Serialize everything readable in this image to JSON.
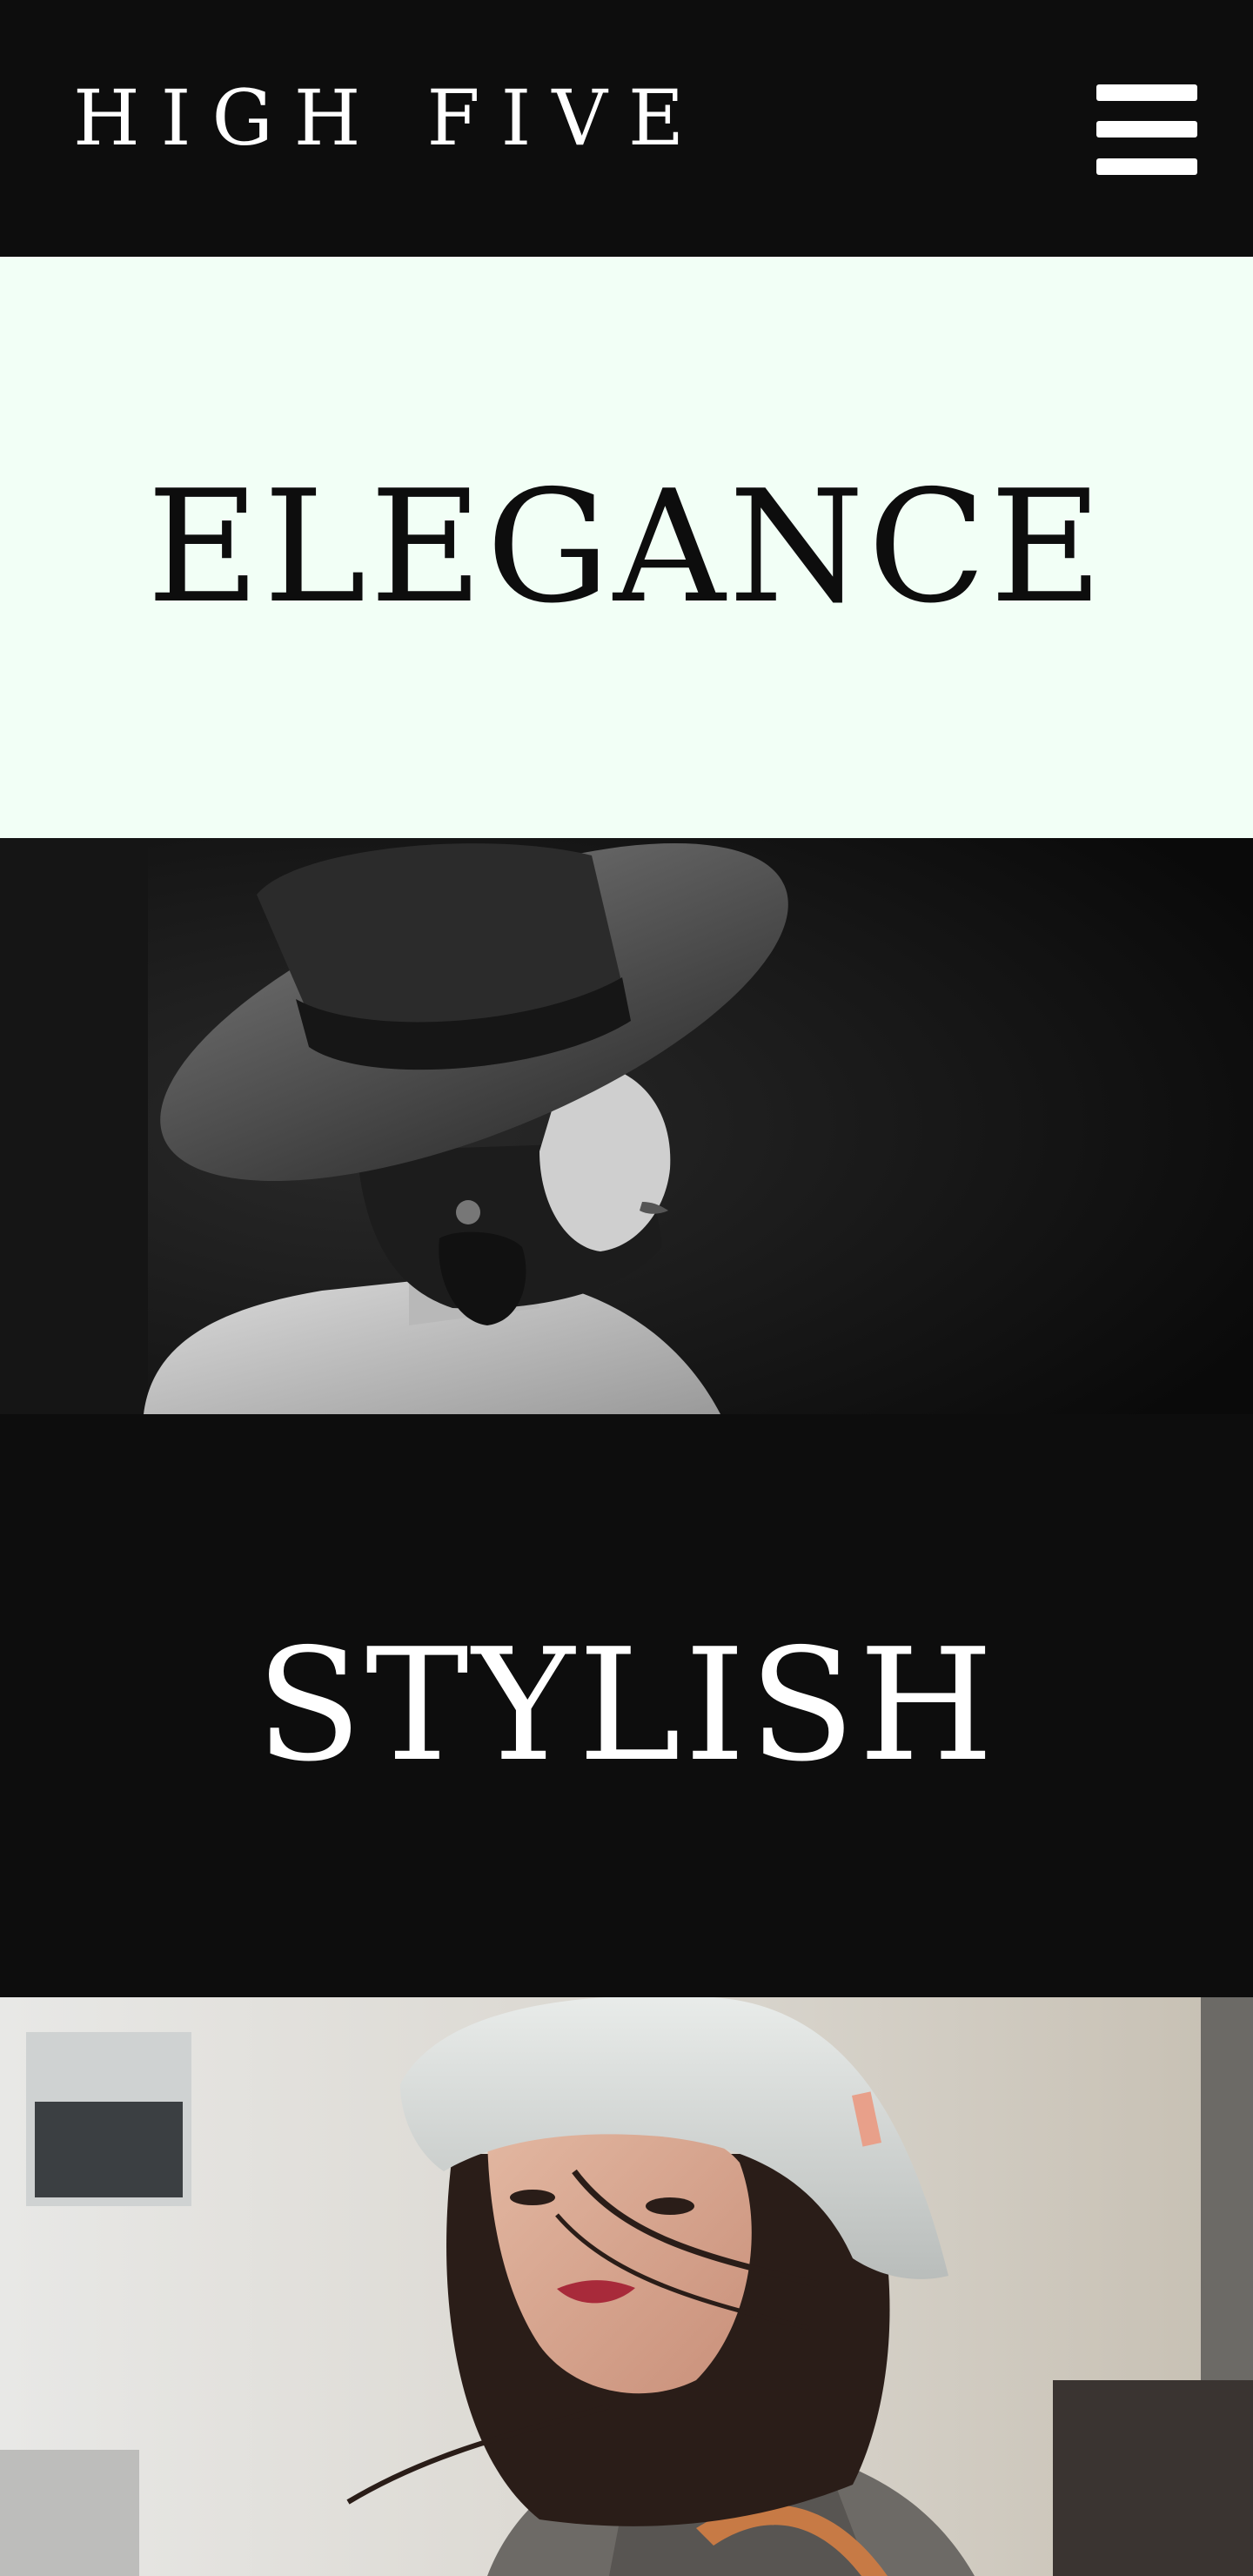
{
  "header": {
    "brand": "HIGH FIVE",
    "menu_icon": "hamburger-menu-icon"
  },
  "sections": [
    {
      "headline": "ELEGANCE"
    },
    {
      "image": "woman-black-hat-photo"
    },
    {
      "headline": "STYLISH"
    },
    {
      "image": "woman-bucket-hat-photo"
    }
  ],
  "colors": {
    "header_bg": "#0d0d0d",
    "elegance_bg": "#f2fff6",
    "stylish_bg": "#0d0d0d",
    "text_light": "#ffffff",
    "text_dark": "#0d0d0d"
  }
}
